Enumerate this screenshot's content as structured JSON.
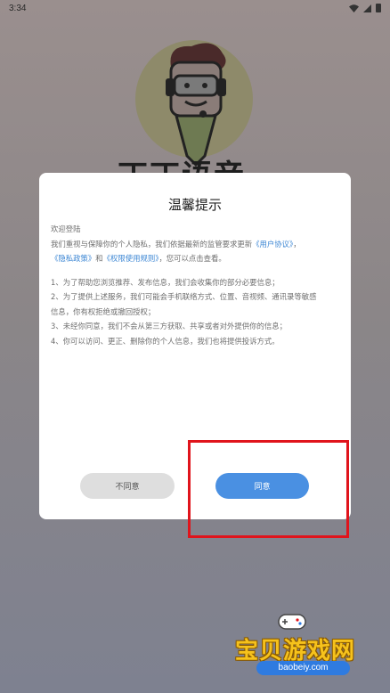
{
  "status_bar": {
    "time": "3:34",
    "icons": [
      "wifi-icon",
      "signal-icon",
      "battery-icon"
    ]
  },
  "background_app": {
    "app_name": "丁丁语音"
  },
  "dialog": {
    "title": "温馨提示",
    "greeting": "欢迎登陆",
    "intro_part1": "我们重视与保障你的个人隐私，我们依据最新的监管要求更新",
    "link_user_agreement": "《用户协议》",
    "intro_part2": "，",
    "link_privacy_policy": "《隐私政策》",
    "intro_part3": "和",
    "link_permission_rules": "《权限使用规则》",
    "intro_part4": "，您可以点击查看。",
    "item1": "1、为了帮助您浏览推荐、发布信息，我们会收集你的部分必要信息；",
    "item2_line1": "2、为了提供上述服务，我们可能会手机联络方式、位置、音视频、通讯录等敏感",
    "item2_line2": "信息，你有权拒绝或撤回授权；",
    "item3": "3、未经你同意，我们不会从第三方获取、共享或者对外提供你的信息；",
    "item4": "4、你可以访问、更正、删除你的个人信息，我们也将提供投诉方式。",
    "disagree_label": "不同意",
    "agree_label": "同意"
  },
  "watermark": {
    "text": "宝贝游戏网",
    "url": "baobeiy.com"
  },
  "colors": {
    "agree_button": "#4a90e2",
    "disagree_button": "#dedede",
    "link": "#3d87d4",
    "highlight": "#e0141c",
    "watermark_text": "#f6c21c"
  }
}
